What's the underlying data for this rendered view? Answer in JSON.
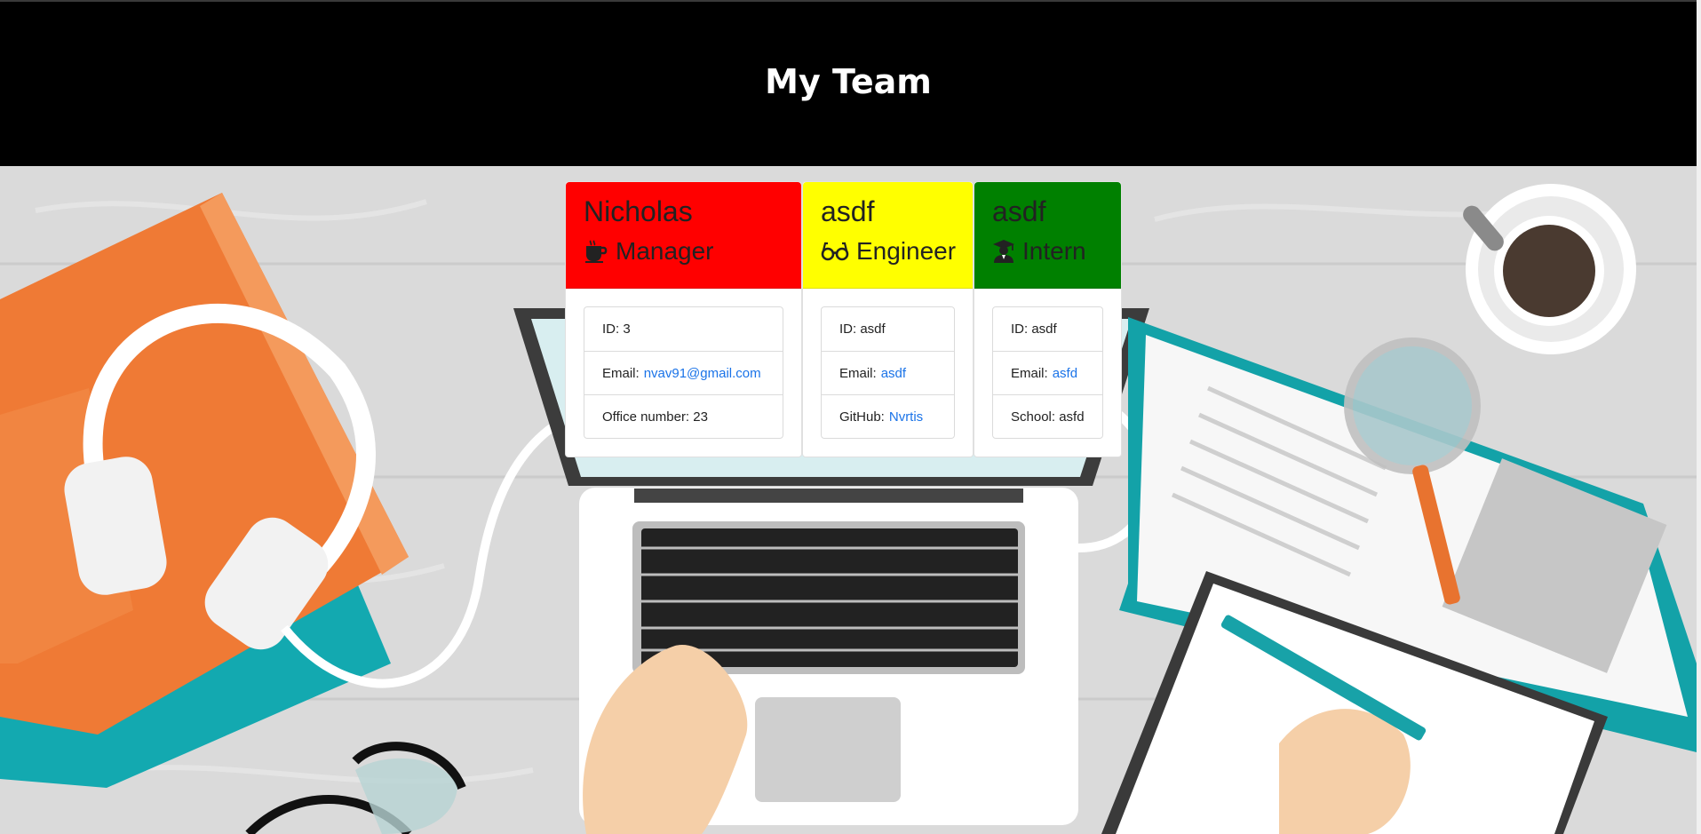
{
  "header": {
    "title": "My Team"
  },
  "colors": {
    "manager": "#ff0000",
    "engineer": "#ffff00",
    "intern": "#008000"
  },
  "cards": [
    {
      "name": "Nicholas",
      "role": "Manager",
      "icon": "coffee-icon",
      "fields": [
        {
          "label": "ID: ",
          "value": "3"
        },
        {
          "label": "Email:",
          "value": "nvav91@gmail.com"
        },
        {
          "label": "Office number: ",
          "value": "23"
        }
      ]
    },
    {
      "name": "asdf",
      "role": "Engineer",
      "icon": "glasses-icon",
      "fields": [
        {
          "label": "ID: ",
          "value": "asdf"
        },
        {
          "label": "Email:",
          "value": "asdf"
        },
        {
          "label": "GitHub:",
          "value": "Nvrtis"
        }
      ]
    },
    {
      "name": "asdf",
      "role": "Intern",
      "icon": "graduate-icon",
      "fields": [
        {
          "label": "ID: ",
          "value": "asdf"
        },
        {
          "label": "Email:",
          "value": "asfd"
        },
        {
          "label": "School: ",
          "value": "asfd"
        }
      ]
    }
  ]
}
